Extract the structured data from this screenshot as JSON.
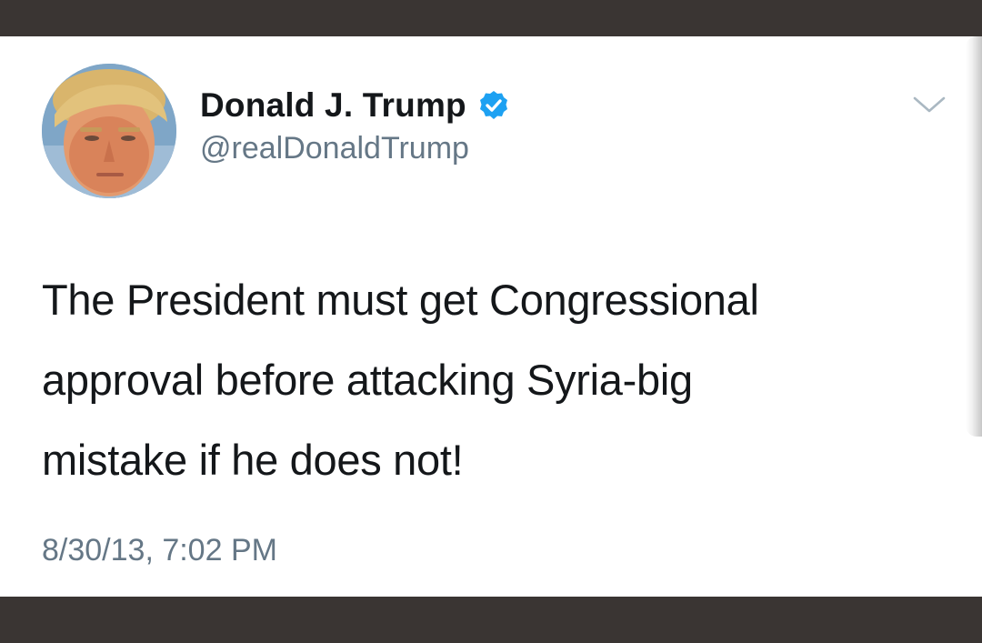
{
  "tweet": {
    "display_name": "Donald J. Trump",
    "handle": "@realDonaldTrump",
    "verified": true,
    "text": "The President must get Congressional\napproval before attacking Syria-big\nmistake if he does not!",
    "timestamp": "8/30/13, 7:02 PM"
  },
  "icons": {
    "avatar": "profile-photo",
    "verified": "verified-badge-icon",
    "menu": "chevron-down-icon"
  },
  "colors": {
    "background_bar": "#3a3533",
    "card": "#ffffff",
    "text_primary": "#14171a",
    "text_secondary": "#657786",
    "verified_blue": "#1da1f2",
    "chevron": "#aab8c2"
  }
}
